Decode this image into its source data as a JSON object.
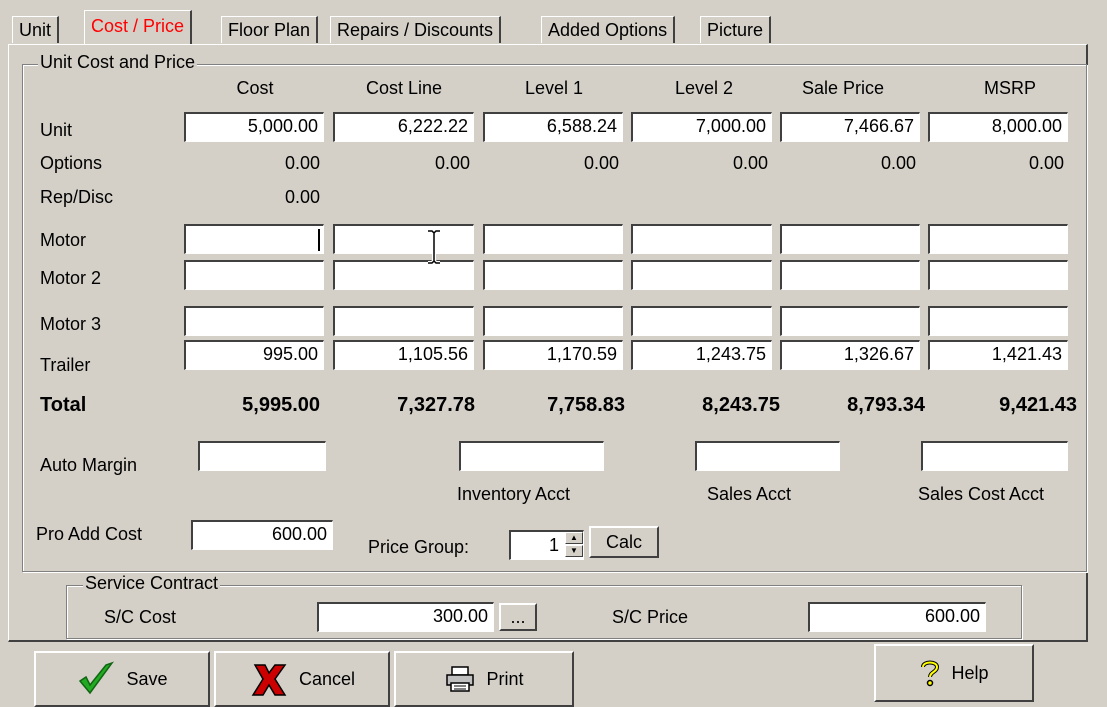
{
  "tabs": [
    {
      "label": "Unit",
      "active": false
    },
    {
      "label": "Cost / Price",
      "active": true
    },
    {
      "label": "Floor Plan",
      "active": false
    },
    {
      "label": "Repairs / Discounts",
      "active": false
    },
    {
      "label": "Added Options",
      "active": false
    },
    {
      "label": "Picture",
      "active": false
    }
  ],
  "group_title": "Unit Cost and Price",
  "columns": [
    "Cost",
    "Cost Line",
    "Level 1",
    "Level 2",
    "Sale Price",
    "MSRP"
  ],
  "rows": {
    "unit": {
      "label": "Unit",
      "values": [
        "5,000.00",
        "6,222.22",
        "6,588.24",
        "7,000.00",
        "7,466.67",
        "8,000.00"
      ]
    },
    "options": {
      "label": "Options",
      "values": [
        "0.00",
        "0.00",
        "0.00",
        "0.00",
        "0.00",
        "0.00"
      ]
    },
    "repdisc": {
      "label": "Rep/Disc",
      "values": [
        "0.00"
      ]
    },
    "motor": {
      "label": "Motor",
      "values": [
        "",
        "",
        "",
        "",
        "",
        ""
      ]
    },
    "motor2": {
      "label": "Motor 2",
      "values": [
        "",
        "",
        "",
        "",
        "",
        ""
      ]
    },
    "motor3": {
      "label": "Motor 3",
      "values": [
        "",
        "",
        "",
        "",
        "",
        ""
      ]
    },
    "trailer": {
      "label": "Trailer",
      "values": [
        "995.00",
        "1,105.56",
        "1,170.59",
        "1,243.75",
        "1,326.67",
        "1,421.43"
      ]
    },
    "total": {
      "label": "Total",
      "values": [
        "5,995.00",
        "7,327.78",
        "7,758.83",
        "8,243.75",
        "8,793.34",
        "9,421.43"
      ]
    }
  },
  "auto_margin": {
    "label": "Auto Margin",
    "value": ""
  },
  "accounts": {
    "inventory": {
      "label": "Inventory Acct",
      "value": ""
    },
    "sales": {
      "label": "Sales Acct",
      "value": ""
    },
    "sales_cost": {
      "label": "Sales Cost Acct",
      "value": ""
    }
  },
  "pro_add_cost": {
    "label": "Pro Add Cost",
    "value": "600.00"
  },
  "price_group": {
    "label": "Price Group:",
    "value": "1"
  },
  "calc_label": "Calc",
  "service_contract": {
    "title": "Service Contract",
    "cost_label": "S/C Cost",
    "cost_value": "300.00",
    "ellipsis_label": "...",
    "price_label": "S/C Price",
    "price_value": "600.00"
  },
  "buttons": {
    "save": "Save",
    "cancel": "Cancel",
    "print": "Print",
    "help": "Help"
  },
  "colors": {
    "face": "#d4d0c8",
    "active_tab_text": "#ff0000",
    "save_check": "#22aa22",
    "cancel_x": "#cc0000"
  }
}
